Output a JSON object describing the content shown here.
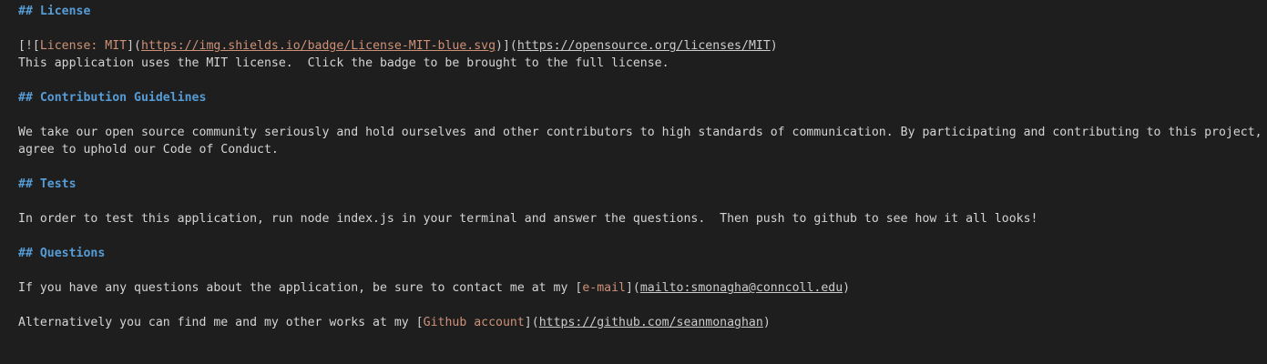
{
  "heading_prefix": "## ",
  "license": {
    "heading": "License",
    "badge_alt": "License: MIT",
    "badge_img_url": "https://img.shields.io/badge/License-MIT-blue.svg",
    "badge_link_url": "https://opensource.org/licenses/MIT",
    "text": "This application uses the MIT license.  Click the badge to be brought to the full license."
  },
  "contribution": {
    "heading": "Contribution Guidelines",
    "text_line1": "We take our open source community seriously and hold ourselves and other contributors to high standards of communication. By participating and contributing to this project, you",
    "text_line2": "agree to uphold our Code of Conduct."
  },
  "tests": {
    "heading": "Tests",
    "text": "In order to test this application, run node index.js in your terminal and answer the questions.  Then push to github to see how it all looks!"
  },
  "questions": {
    "heading": "Questions",
    "email_prefix": "If you have any questions about the application, be sure to contact me at my ",
    "email_link_text": "e-mail",
    "email_url": "mailto:smonagha@conncoll.edu",
    "github_prefix": "Alternatively you can find me and my other works at my ",
    "github_link_text": "Github account",
    "github_url": "https://github.com/seanmonaghan"
  }
}
